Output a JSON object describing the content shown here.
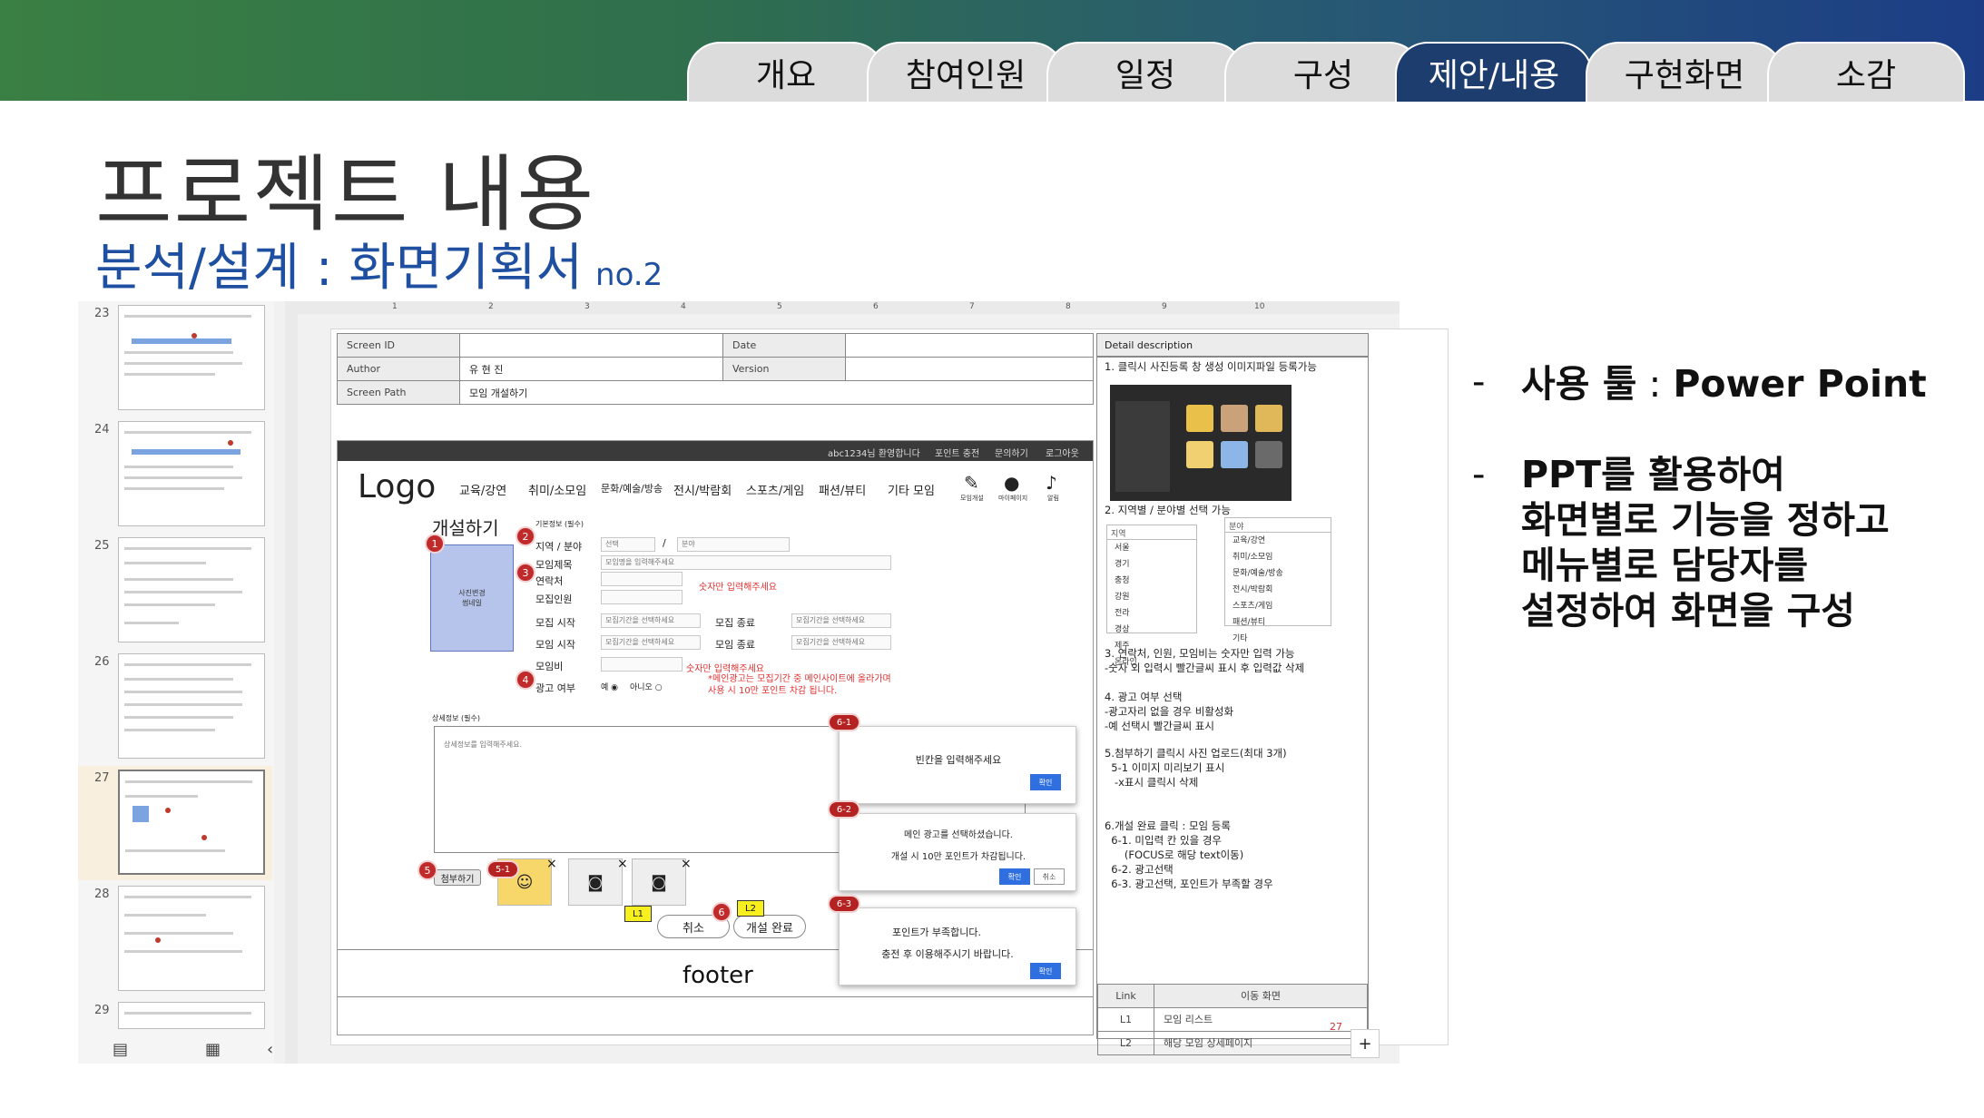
{
  "tabs": [
    {
      "label": "개요",
      "active": false
    },
    {
      "label": "참여인원",
      "active": false
    },
    {
      "label": "일정",
      "active": false
    },
    {
      "label": "구성",
      "active": false
    },
    {
      "label": "제안/내용",
      "active": true
    },
    {
      "label": "구현화면",
      "active": false
    },
    {
      "label": "소감",
      "active": false
    }
  ],
  "title": "프로젝트 내용",
  "subtitle": "분석/설계 : 화면기획서",
  "subtitle_no": "no.2",
  "colors": {
    "tab_active": "#1c3d6e",
    "subtitle": "#1f4fa0",
    "badge": "#c02a2a",
    "highlight": "#f7f01e",
    "dialog_button": "#2f6fe0"
  },
  "thumbnails": {
    "numbers": [
      "23",
      "24",
      "25",
      "26",
      "27",
      "28",
      "29"
    ],
    "selected": "27",
    "bottom_icons": [
      "grid-view-icon",
      "filmstrip-view-icon",
      "collapse-chevron-icon"
    ]
  },
  "ruler": [
    "1",
    "2",
    "3",
    "4",
    "5",
    "6",
    "7",
    "8",
    "9",
    "10"
  ],
  "spec": {
    "screen_id_label": "Screen ID",
    "screen_id_value": "",
    "date_label": "Date",
    "date_value": "",
    "author_label": "Author",
    "author_value": "유 현 진",
    "version_label": "Version",
    "version_value": "",
    "path_label": "Screen Path",
    "path_value": "모임 개설하기"
  },
  "detail": {
    "header": "Detail description",
    "d1": "1. 클릭시 사진등록 창 생성 이미지파일 등록가능",
    "d2": "2. 지역별 / 분야별 선택 가능",
    "region_header": "지역",
    "regions": [
      "서울",
      "경기",
      "충청",
      "강원",
      "전라",
      "경상",
      "제주",
      "온라인"
    ],
    "field_header": "분야",
    "fields": [
      "교육/강연",
      "취미/소모임",
      "문화/예술/방송",
      "전시/박람회",
      "스포츠/게임",
      "패션/뷰티",
      "기타"
    ],
    "d3": "3. 연락처, 인원, 모임비는 숫자만 입력 가능\n-숫자 외 입력시 빨간글씨 표시 후 입력값 삭제",
    "d4": "4. 광고 여부 선택\n-광고자리 없을 경우 비활성화\n-예 선택시 빨간글씨 표시",
    "d5": "5.첨부하기 클릭시 사진 업로드(최대 3개)\n  5-1 이미지 미리보기 표시\n   -x표시 클릭시 삭제",
    "d6": "6.개설 완료 클릭 : 모임 등록\n  6-1. 미입력 칸 있을 경우\n      (FOCUS로 해당 text이동)\n  6-2. 광고선택\n  6-3. 광고선택, 포인트가 부족할 경우",
    "link_header": "Link",
    "move_header": "이동 화면",
    "links": [
      {
        "id": "L1",
        "target": "모임 리스트"
      },
      {
        "id": "L2",
        "target": "해당 모임 상세페이지"
      }
    ]
  },
  "mock": {
    "topbar": [
      "abc1234님 환영합니다",
      "포인트 충전",
      "문의하기",
      "로그아웃"
    ],
    "logo": "Logo",
    "menu": [
      "교육/강연",
      "취미/소모임",
      "문화/예술/방송",
      "전시/박람회",
      "스포츠/게임",
      "패션/뷰티",
      "기타 모임"
    ],
    "icons": [
      {
        "icon": "create-meeting-icon",
        "label": "모임개설"
      },
      {
        "icon": "user-icon",
        "label": "마이페이지"
      },
      {
        "icon": "bell-icon",
        "label": "알림"
      }
    ],
    "page_title": "개설하기",
    "photo_text": "사진변경\n썸네일",
    "basic_info": "기본정보 (필수)",
    "region_label": "지역 / 분야",
    "region_select": "선택",
    "field_select": "분야",
    "name_label": "모임제목",
    "name_placeholder": "모임명을 입력해주세요",
    "contact_label": "연락처",
    "members_label": "모집인원",
    "numbers_only_warning": "숫자만 입력해주세요",
    "recruit_start_label": "모집 시작",
    "recruit_end_label": "모집 종료",
    "meet_start_label": "모임 시작",
    "meet_end_label": "모임 종료",
    "date_placeholder": "모집기간을 선택하세요",
    "fee_label": "모임비",
    "fee_warning": "숫자만 입력해주세요",
    "ad_label": "광고 여부",
    "ad_yes": "예",
    "ad_no": "아니오",
    "ad_note": "*메인광고는 모집기간 중 메인사이트에 올라가며\n사용 시 10만 포인트 차감 됩니다.",
    "detail_info": "상세정보 (필수)",
    "detail_placeholder": "상세정보를 입력해주세요.",
    "attach_label": "첨부하기",
    "cancel_label": "취소",
    "submit_label": "개설 완료",
    "footer": "footer"
  },
  "callouts": {
    "c1": "1",
    "c2": "2",
    "c3": "3",
    "c4": "4",
    "c5": "5",
    "c51": "5-1",
    "c6": "6",
    "c61": "6-1",
    "c62": "6-2",
    "c63": "6-3",
    "l1": "L1",
    "l2": "L2"
  },
  "dialogs": {
    "d61_msg": "빈칸을 입력해주세요",
    "d62_msg1": "메인 광고를 선택하셨습니다.",
    "d62_msg2": "개설 시 10만 포인트가 차감됩니다.",
    "d63_msg1": "포인트가 부족합니다.",
    "d63_msg2": "충전 후 이용해주시기 바랍니다.",
    "confirm": "확인",
    "cancel": "취소"
  },
  "slide_page_number": "27",
  "bullets": {
    "dash": "-",
    "b1_bold": "사용 툴",
    "b1_sep": " : ",
    "b1_tool": "Power Point",
    "b2": "PPT를 활용하여\n화면별로 기능을 정하고\n메뉴별로 담당자를\n설정하여 화면을 구성"
  }
}
